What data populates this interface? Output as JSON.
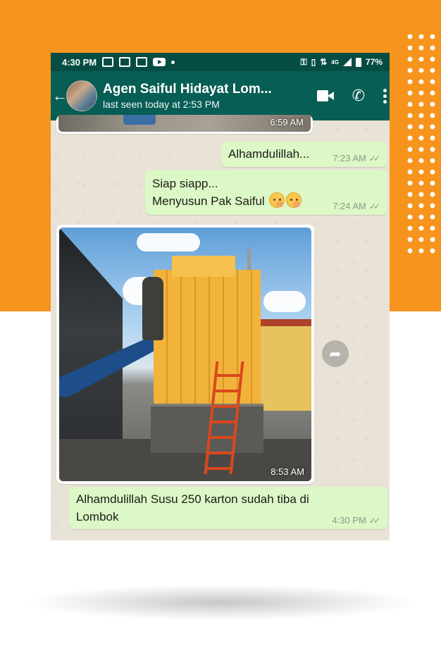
{
  "status_bar": {
    "time": "4:30 PM",
    "network": "4G",
    "battery": "77%"
  },
  "header": {
    "contact_name": "Agen Saiful Hidayat Lom...",
    "last_seen": "last seen today at 2:53 PM"
  },
  "messages": [
    {
      "direction": "in",
      "type": "image",
      "time": "6:59 AM"
    },
    {
      "direction": "out",
      "type": "text",
      "lines": [
        "Alhamdulillah..."
      ],
      "time": "7:23 AM",
      "status": "read"
    },
    {
      "direction": "out",
      "type": "text",
      "lines": [
        "Siap siapp...",
        "Menyusun Pak Saiful"
      ],
      "emoji": [
        "face-with-hand-over-mouth",
        "face-with-hand-over-mouth"
      ],
      "time": "7:24 AM",
      "status": "read"
    },
    {
      "direction": "in",
      "type": "image",
      "time": "8:53 AM"
    },
    {
      "direction": "out",
      "type": "text",
      "lines": [
        "Alhamdulillah Susu 250 karton sudah tiba di",
        "Lombok"
      ],
      "time": "4:30 PM",
      "status": "read"
    }
  ],
  "colors": {
    "background_accent": "#f7941d",
    "header": "#075e54",
    "status_bar": "#054d44",
    "outgoing_bubble": "#dcf8c6",
    "incoming_bubble": "#ffffff"
  }
}
